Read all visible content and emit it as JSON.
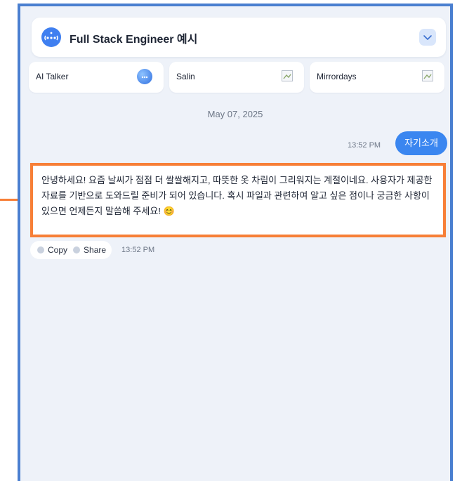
{
  "header": {
    "title": "Full Stack Engineer 예시"
  },
  "tabs": [
    {
      "label": "AI Talker",
      "thumb": "globe-avatar"
    },
    {
      "label": "Salin",
      "thumb": "broken-image"
    },
    {
      "label": "Mirrordays",
      "thumb": "broken-image"
    }
  ],
  "chat": {
    "date": "May 07, 2025",
    "user_message": {
      "text": "자기소개",
      "time": "13:52 PM"
    },
    "bot_message": {
      "text": "안녕하세요! 요즘 날씨가 점점 더 쌀쌀해지고, 따뜻한 옷 차림이 그리워지는 계절이네요. 사용자가 제공한 자료를 기반으로 도와드릴 준비가 되어 있습니다. 혹시 파일과 관련하여 알고 싶은 점이나 궁금한 사항이 있으면 언제든지 말씀해 주세요! 😊",
      "time": "13:52 PM"
    },
    "actions": {
      "copy_label": "Copy",
      "share_label": "Share"
    }
  },
  "colors": {
    "frame": "#4a7fd0",
    "accent": "#3a86f0",
    "highlight": "#f77f37"
  }
}
